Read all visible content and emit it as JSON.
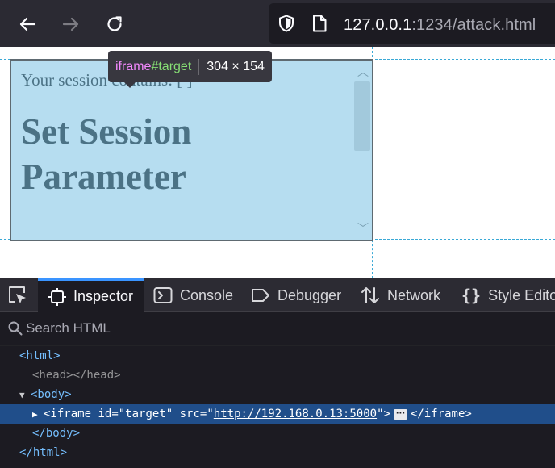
{
  "browser": {
    "url_host": "127.0.0.1",
    "url_path": ":1234/attack.html"
  },
  "iframe": {
    "session_text": "Your session contains: [ ]",
    "heading": "Set Session Parameter"
  },
  "tooltip": {
    "tag": "iframe",
    "id": "#target",
    "size": "304 × 154"
  },
  "devtools": {
    "tabs": [
      {
        "label": "Inspector",
        "icon": "inspector-icon",
        "active": true
      },
      {
        "label": "Console",
        "icon": "console-icon",
        "active": false
      },
      {
        "label": "Debugger",
        "icon": "debugger-icon",
        "active": false
      },
      {
        "label": "Network",
        "icon": "network-icon",
        "active": false
      },
      {
        "label": "Style Editor",
        "icon": "style-editor-icon",
        "active": false
      }
    ],
    "search_placeholder": "Search HTML",
    "markup": {
      "html_open": "<html>",
      "head": "<head></head>",
      "body_open": "<body>",
      "iframe_open": "<iframe",
      "iframe_attr_id_name": "id",
      "iframe_attr_id_value": "\"target\"",
      "iframe_attr_src_name": "src",
      "iframe_attr_src_value": "http://192.168.0.13:5000",
      "iframe_close": "</iframe>",
      "body_close": "</body>",
      "html_close": "</html>"
    }
  },
  "colors": {
    "accent": "#3a94ff",
    "selection": "#204e8a",
    "highlight": "#81c4e6"
  }
}
